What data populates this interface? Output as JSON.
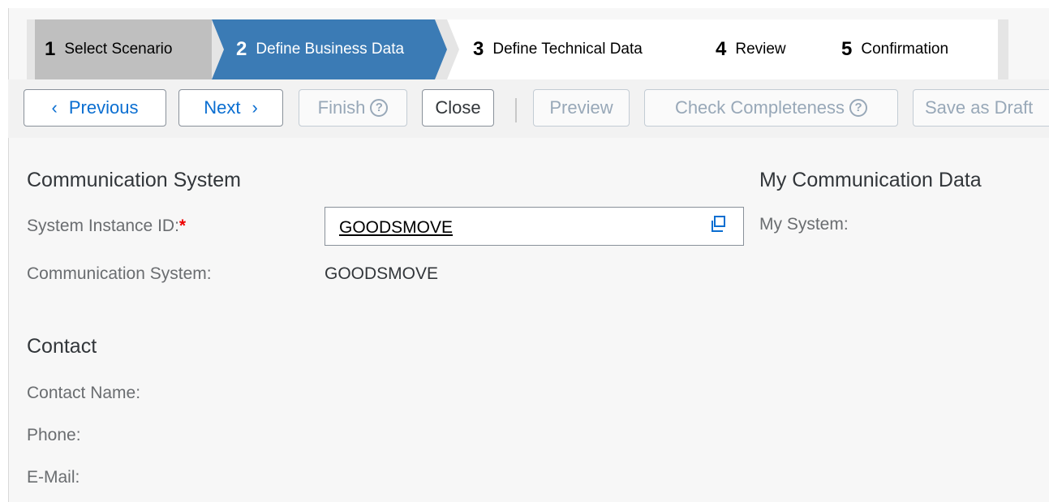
{
  "wizard": {
    "steps": [
      {
        "num": "1",
        "label": "Select Scenario"
      },
      {
        "num": "2",
        "label": "Define Business Data"
      },
      {
        "num": "3",
        "label": "Define Technical Data"
      },
      {
        "num": "4",
        "label": "Review"
      },
      {
        "num": "5",
        "label": "Confirmation"
      }
    ],
    "active_step": "2",
    "active_color": "#3b7bb5"
  },
  "toolbar": {
    "previous_chevron": "‹",
    "previous_label": "Previous",
    "next_label": "Next",
    "next_chevron": "›",
    "finish_label": "Finish",
    "close_label": "Close",
    "preview_label": "Preview",
    "check_completeness_label": "Check Completeness",
    "save_as_draft_label": "Save as Draft",
    "help_icon": "question-circle-icon"
  },
  "communication_system": {
    "title": "Communication System",
    "system_instance_label": "System Instance ID:",
    "required_marker": "*",
    "system_instance_value": "GOODSMOVE",
    "value_help_icon": "value-help-icon",
    "comm_system_label": "Communication System:",
    "comm_system_value": "GOODSMOVE"
  },
  "my_comm_data": {
    "title": "My Communication Data",
    "my_system_label": "My System:"
  },
  "contact": {
    "title": "Contact",
    "name_label": "Contact Name:",
    "phone_label": "Phone:",
    "email_label": "E-Mail:"
  }
}
